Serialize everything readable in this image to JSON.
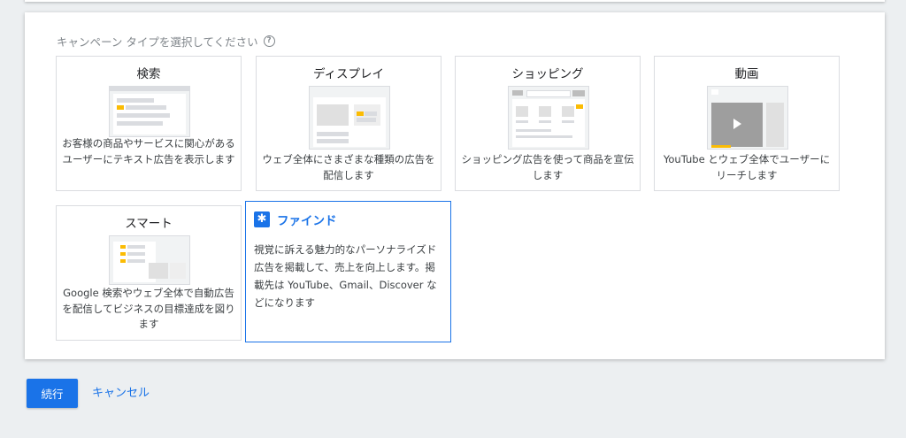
{
  "panel": {
    "prompt": "キャンペーン タイプを選択してください",
    "help_icon": "?"
  },
  "cards": {
    "search": {
      "title": "検索",
      "description": "お客様の商品やサービスに関心があるユーザーにテキスト広告を表示します"
    },
    "display": {
      "title": "ディスプレイ",
      "description": "ウェブ全体にさまざまな種類の広告を配信します"
    },
    "shopping": {
      "title": "ショッピング",
      "description": "ショッピング広告を使って商品を宣伝します"
    },
    "video": {
      "title": "動画",
      "description": "YouTube とウェブ全体でユーザーにリーチします"
    },
    "smart": {
      "title": "スマート",
      "description": "Google 検索やウェブ全体で自動広告を配信してビジネスの目標達成を図ります"
    },
    "discovery": {
      "title": "ファインド",
      "description": "視覚に訴える魅力的なパーソナライズド広告を掲載して、売上を向上します。掲載先は YouTube、Gmail、Discover などになります",
      "icon": "✱",
      "selected": true
    }
  },
  "actions": {
    "continue_label": "続行",
    "cancel_label": "キャンセル"
  },
  "colors": {
    "accent": "#1a73e8",
    "highlight": "#fbbc04",
    "background": "#eceff1"
  }
}
